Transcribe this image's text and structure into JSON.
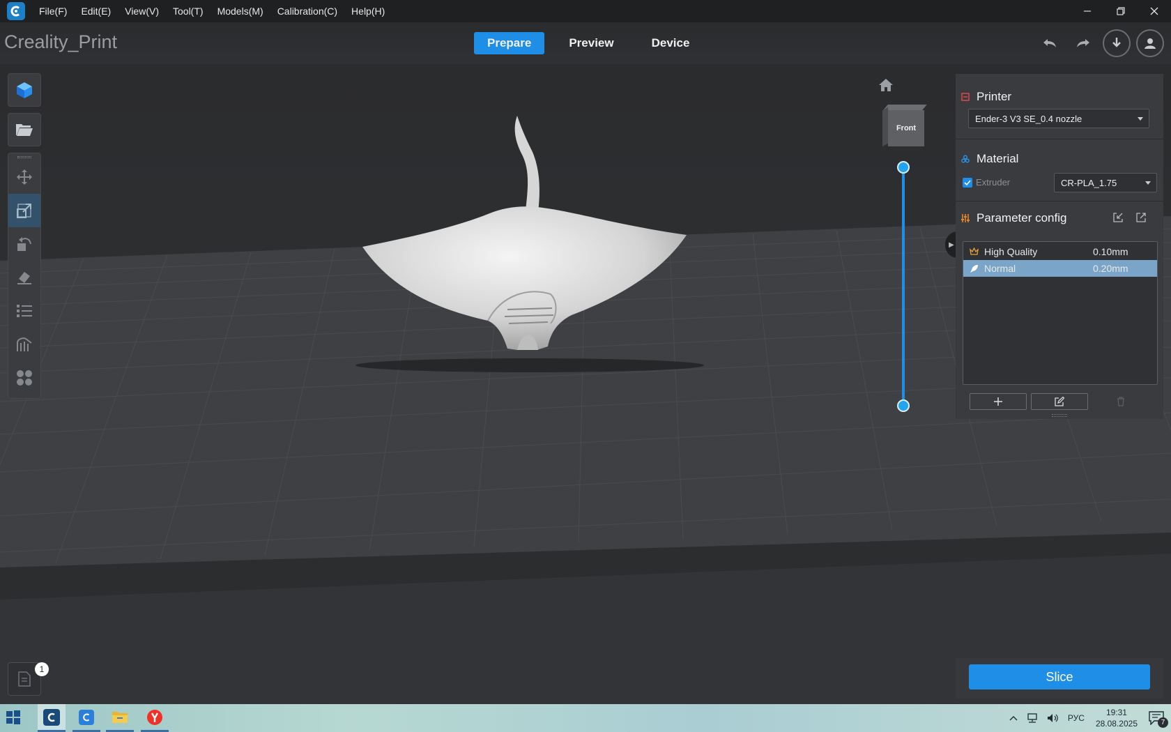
{
  "window": {
    "menu": [
      "File(F)",
      "Edit(E)",
      "View(V)",
      "Tool(T)",
      "Models(M)",
      "Calibration(C)",
      "Help(H)"
    ]
  },
  "header": {
    "brand": "Creality_Print",
    "tabs": [
      "Prepare",
      "Preview",
      "Device"
    ],
    "active_tab": "Prepare"
  },
  "viewport": {
    "view_cube_face": "Front"
  },
  "panel": {
    "printer_title": "Printer",
    "printer_value": "Ender-3 V3 SE_0.4 nozzle",
    "material_title": "Material",
    "extruder_label": "Extruder",
    "extruder_checked": true,
    "material_value": "CR-PLA_1.75",
    "param_title": "Parameter config",
    "profiles": [
      {
        "name": "High Quality",
        "value": "0.10mm",
        "icon": "crown-icon"
      },
      {
        "name": "Normal",
        "value": "0.20mm",
        "icon": "rocket-icon"
      }
    ],
    "selected_profile": "Normal"
  },
  "bottom": {
    "doc_badge": "1",
    "slice_label": "Slice"
  },
  "taskbar": {
    "lang": "РУС",
    "time": "19:31",
    "date": "28.08.2025",
    "notification_count": "7"
  },
  "colors": {
    "accent": "#1f8ee6",
    "panel_bg": "#393b3e",
    "viewport_bg": "#2b2c2e",
    "selected_row": "#7aa5c8"
  }
}
